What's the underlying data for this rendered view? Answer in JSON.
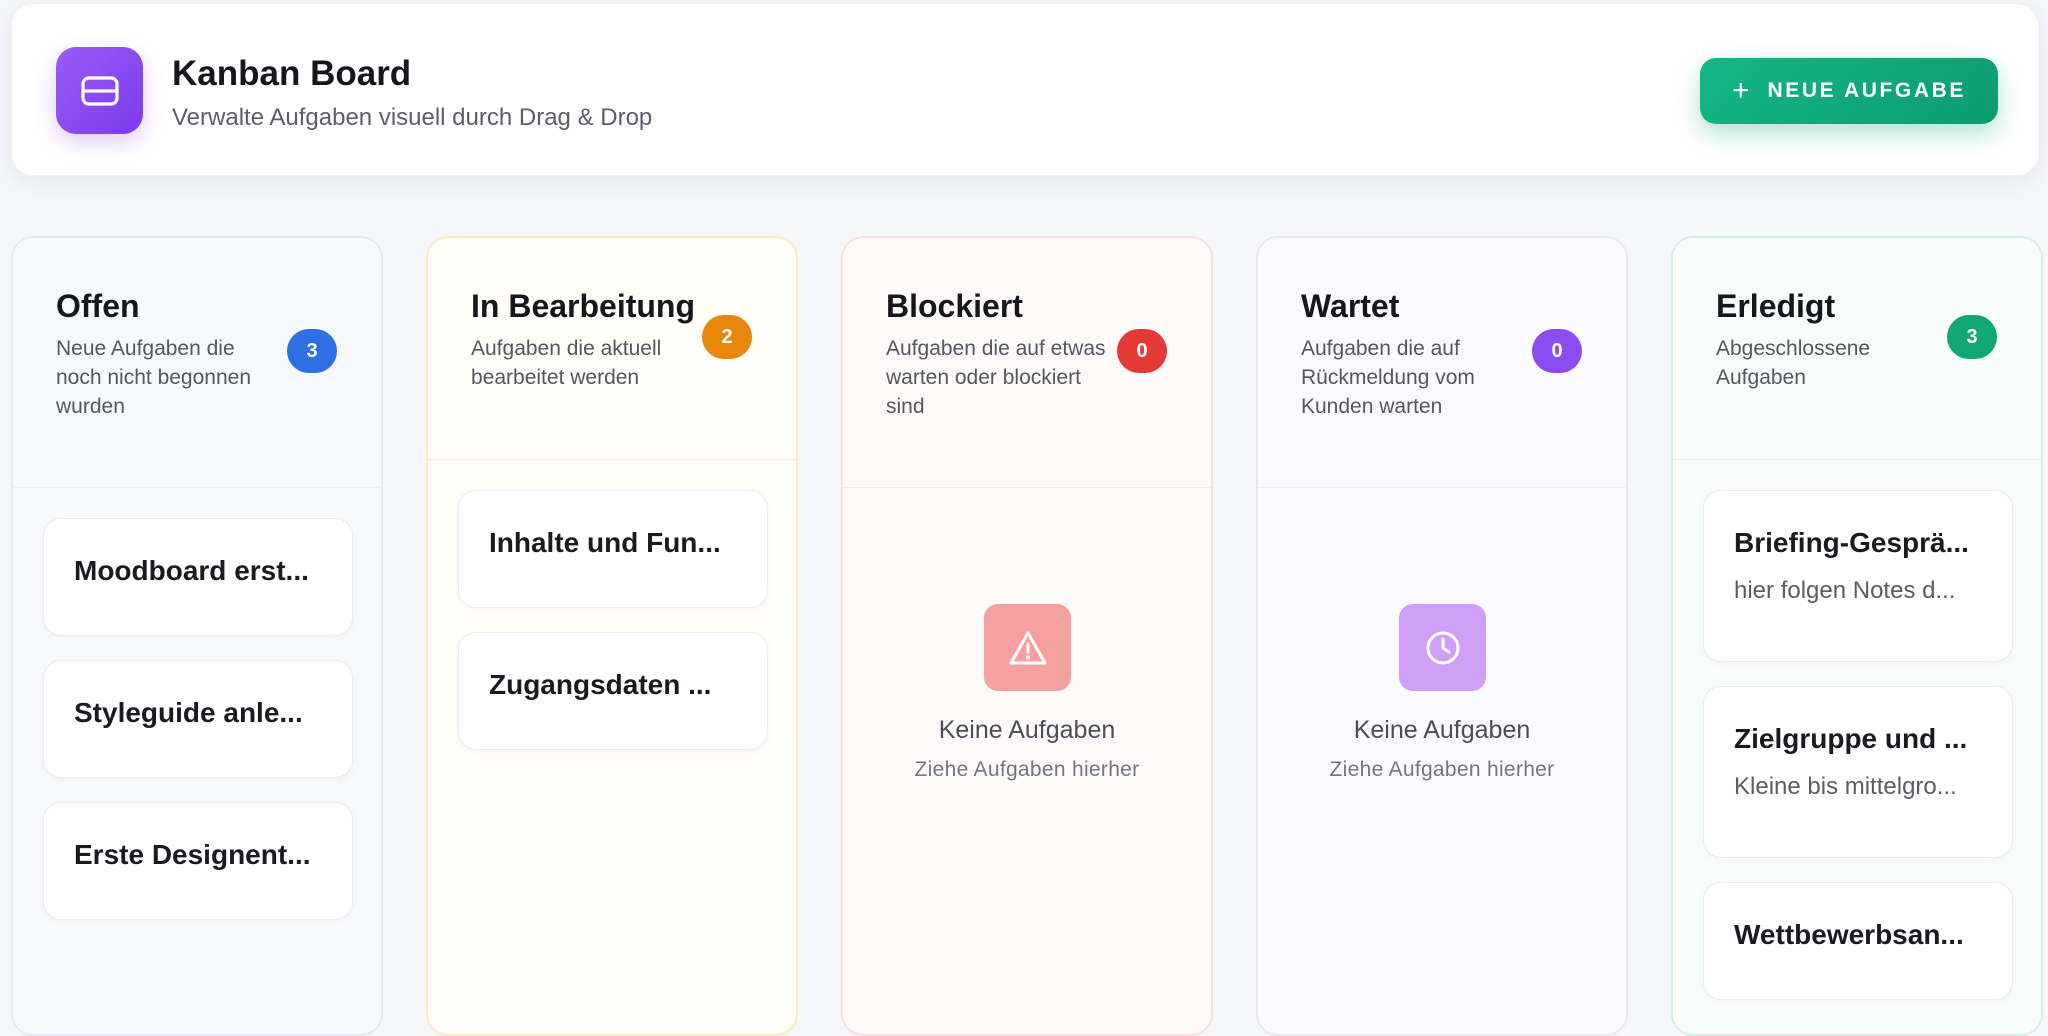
{
  "header": {
    "icon": "card-icon",
    "title": "Kanban Board",
    "subtitle": "Verwalte Aufgaben visuell durch Drag & Drop",
    "new_button": {
      "icon": "plus",
      "label": "NEUE AUFGABE"
    }
  },
  "columns": [
    {
      "title": "Offen",
      "description": "Neue Aufgaben die noch nicht begonnen wurden",
      "count": "3",
      "accent": "#2f6fe4",
      "cards": [
        {
          "title": "Moodboard erst..."
        },
        {
          "title": "Styleguide anle..."
        },
        {
          "title": "Erste Designent..."
        }
      ]
    },
    {
      "title": "In Bearbeitung",
      "description": "Aufgaben die aktuell bearbeitet werden",
      "count": "2",
      "accent": "#e8870c",
      "cards": [
        {
          "title": "Inhalte und Fun..."
        },
        {
          "title": "Zugangsdaten ..."
        }
      ]
    },
    {
      "title": "Blockiert",
      "description": "Aufgaben die auf etwas warten oder blockiert sind",
      "count": "0",
      "accent": "#e53935",
      "cards": [],
      "empty": {
        "icon": "warning-icon",
        "title": "Keine Aufgaben",
        "subtitle": "Ziehe Aufgaben hierher"
      }
    },
    {
      "title": "Wartet",
      "description": "Aufgaben die auf Rückmeldung vom Kunden warten",
      "count": "0",
      "accent": "#8b4cf0",
      "cards": [],
      "empty": {
        "icon": "clock-icon",
        "title": "Keine Aufgaben",
        "subtitle": "Ziehe Aufgaben hierher"
      }
    },
    {
      "title": "Erledigt",
      "description": "Abgeschlossene Aufgaben",
      "count": "3",
      "accent": "#12a876",
      "cards": [
        {
          "title": "Briefing-Gesprä...",
          "note": "hier folgen Notes d..."
        },
        {
          "title": "Zielgruppe und ...",
          "note": "Kleine bis mittelgro..."
        },
        {
          "title": "Wettbewerbsan..."
        }
      ]
    }
  ]
}
